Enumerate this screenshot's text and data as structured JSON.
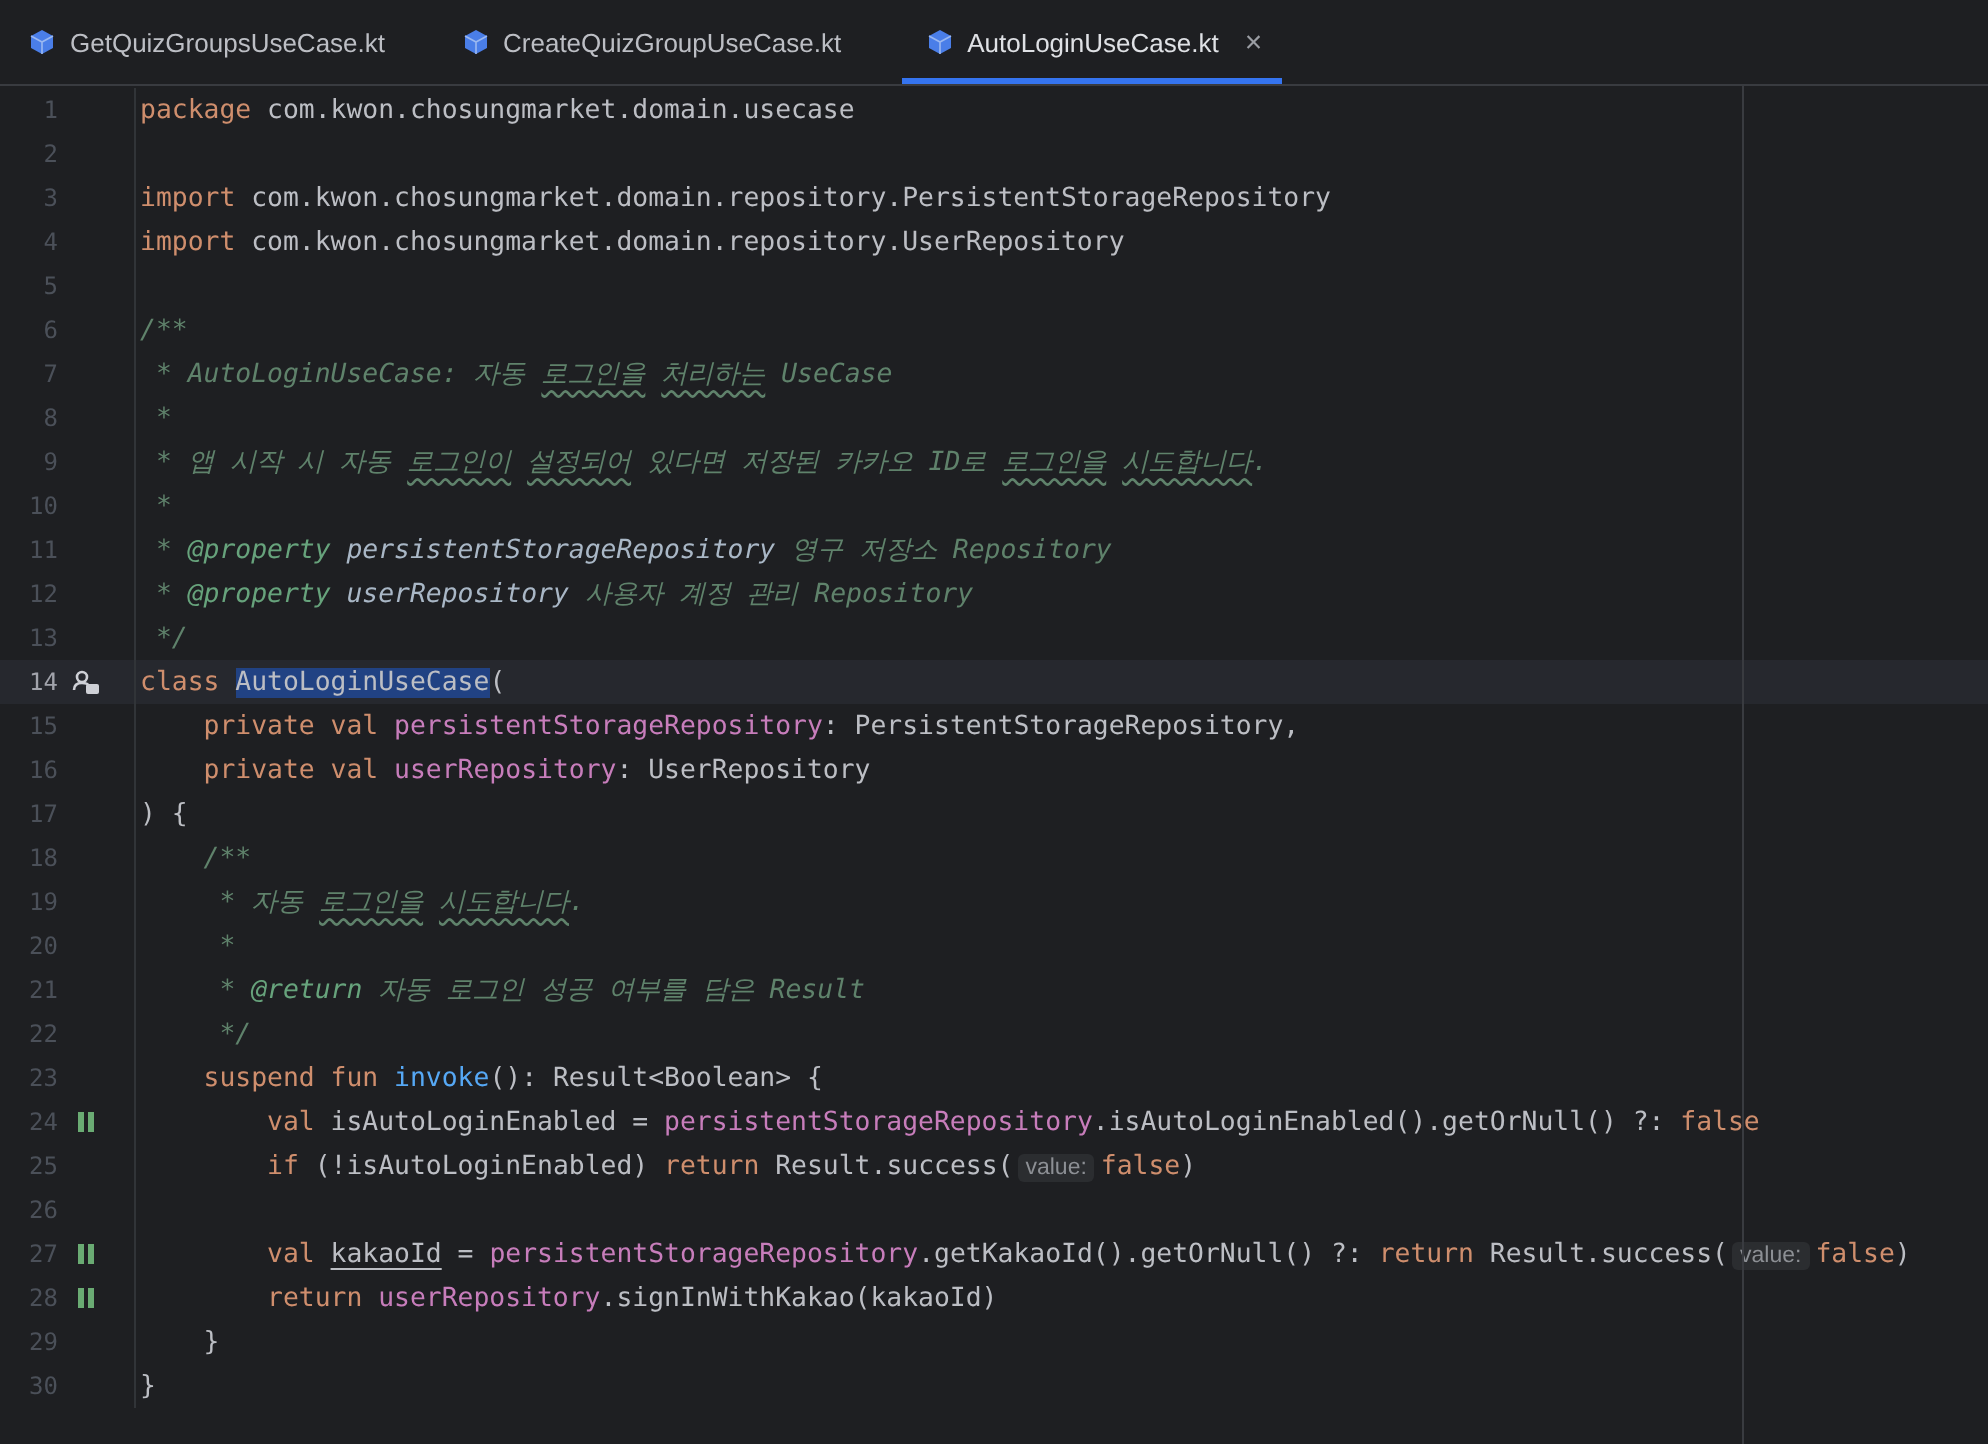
{
  "tabs": [
    {
      "label": "GetQuizGroupsUseCase.kt",
      "selected": false
    },
    {
      "label": "CreateQuizGroupUseCase.kt",
      "selected": false
    },
    {
      "label": "AutoLoginUseCase.kt",
      "selected": true,
      "close": "×"
    }
  ],
  "editor": {
    "lines": [
      {
        "number": "1",
        "tokens": [
          {
            "kind": "keyword",
            "text": "package"
          },
          {
            "kind": "plain",
            "text": " com.kwon.chosungmarket.domain.usecase"
          }
        ]
      },
      {
        "number": "2"
      },
      {
        "number": "3",
        "tokens": [
          {
            "kind": "keyword",
            "text": "import"
          },
          {
            "kind": "plain",
            "text": " com.kwon.chosungmarket.domain.repository.PersistentStorageRepository"
          }
        ]
      },
      {
        "number": "4",
        "tokens": [
          {
            "kind": "keyword",
            "text": "import"
          },
          {
            "kind": "plain",
            "text": " com.kwon.chosungmarket.domain.repository.UserRepository"
          }
        ]
      },
      {
        "number": "5"
      },
      {
        "number": "6",
        "tokens": [
          {
            "kind": "doc",
            "text": "/**"
          }
        ]
      },
      {
        "number": "7",
        "tokens": [
          {
            "kind": "doc",
            "text": " * AutoLoginUseCase: 자동 "
          },
          {
            "kind": "typo",
            "text": "로그인을 "
          },
          {
            "kind": "typo",
            "text": "처리하는"
          },
          {
            "kind": "doc",
            "text": " UseCase"
          }
        ]
      },
      {
        "number": "8",
        "tokens": [
          {
            "kind": "doc",
            "text": " *"
          }
        ]
      },
      {
        "number": "9",
        "tokens": [
          {
            "kind": "doc",
            "text": " * 앱 시작 시 자동 "
          },
          {
            "kind": "typo",
            "text": "로그인이 "
          },
          {
            "kind": "typo",
            "text": "설정되어"
          },
          {
            "kind": "doc",
            "text": " 있다면 저장된 카카오 ID로 "
          },
          {
            "kind": "typo",
            "text": "로그인을 "
          },
          {
            "kind": "typo",
            "text": "시도합니다"
          },
          {
            "kind": "doc",
            "text": "."
          }
        ]
      },
      {
        "number": "10",
        "tokens": [
          {
            "kind": "doc",
            "text": " *"
          }
        ]
      },
      {
        "number": "11",
        "tokens": [
          {
            "kind": "doc",
            "text": " * "
          },
          {
            "kind": "doc_tag",
            "text": "@property "
          },
          {
            "kind": "doc_param",
            "text": "persistentStorageRepository"
          },
          {
            "kind": "doc",
            "text": " 영구 저장소 Repository"
          }
        ]
      },
      {
        "number": "12",
        "tokens": [
          {
            "kind": "doc",
            "text": " * "
          },
          {
            "kind": "doc_tag",
            "text": "@property "
          },
          {
            "kind": "doc_param",
            "text": "userRepository"
          },
          {
            "kind": "doc",
            "text": " 사용자 계정 관리 Repository"
          }
        ]
      },
      {
        "number": "13",
        "tokens": [
          {
            "kind": "doc",
            "text": " */"
          }
        ]
      },
      {
        "number": "14",
        "current": true,
        "gutter_icon": {
          "kind": "author"
        },
        "tokens": [
          {
            "kind": "keyword",
            "text": "class "
          },
          {
            "kind": "selection",
            "text": "AutoLoginUseCase"
          },
          {
            "kind": "plain",
            "text": "("
          }
        ]
      },
      {
        "number": "15",
        "tokens": [
          {
            "kind": "keyword",
            "text": "    private val "
          },
          {
            "kind": "property",
            "text": "persistentStorageRepository"
          },
          {
            "kind": "plain",
            "text": ": PersistentStorageRepository,"
          }
        ]
      },
      {
        "number": "16",
        "tokens": [
          {
            "kind": "keyword",
            "text": "    private val "
          },
          {
            "kind": "property",
            "text": "userRepository"
          },
          {
            "kind": "plain",
            "text": ": UserRepository"
          }
        ]
      },
      {
        "number": "17",
        "tokens": [
          {
            "kind": "plain",
            "text": ") {"
          }
        ]
      },
      {
        "number": "18",
        "tokens": [
          {
            "kind": "doc",
            "text": "    /**"
          }
        ]
      },
      {
        "number": "19",
        "tokens": [
          {
            "kind": "doc",
            "text": "     * 자동 "
          },
          {
            "kind": "typo",
            "text": "로그인을 "
          },
          {
            "kind": "typo",
            "text": "시도합니다"
          },
          {
            "kind": "doc",
            "text": "."
          }
        ]
      },
      {
        "number": "20",
        "tokens": [
          {
            "kind": "doc",
            "text": "     *"
          }
        ]
      },
      {
        "number": "21",
        "tokens": [
          {
            "kind": "doc",
            "text": "     * "
          },
          {
            "kind": "doc_tag",
            "text": "@return"
          },
          {
            "kind": "doc",
            "text": " 자동 로그인 성공 여부를 담은 Result"
          }
        ]
      },
      {
        "number": "22",
        "tokens": [
          {
            "kind": "doc",
            "text": "     */"
          }
        ]
      },
      {
        "number": "23",
        "tokens": [
          {
            "kind": "keyword",
            "text": "    suspend fun "
          },
          {
            "kind": "function",
            "text": "invoke"
          },
          {
            "kind": "plain",
            "text": "(): Result<Boolean> {"
          }
        ]
      },
      {
        "number": "24",
        "gutter_icon": {
          "kind": "changed"
        },
        "tokens": [
          {
            "kind": "keyword",
            "text": "        val"
          },
          {
            "kind": "plain",
            "text": " isAutoLoginEnabled = "
          },
          {
            "kind": "property",
            "text": "persistentStorageRepository"
          },
          {
            "kind": "plain",
            "text": ".isAutoLoginEnabled().getOrNull() ?: "
          },
          {
            "kind": "keyword",
            "text": "false"
          }
        ]
      },
      {
        "number": "25",
        "tokens": [
          {
            "kind": "keyword",
            "text": "        if"
          },
          {
            "kind": "plain",
            "text": " (!isAutoLoginEnabled) "
          },
          {
            "kind": "keyword",
            "text": "return"
          },
          {
            "kind": "plain",
            "text": " Result.success("
          },
          {
            "kind": "hint",
            "text": "value:"
          },
          {
            "kind": "keyword",
            "text": "false"
          },
          {
            "kind": "plain",
            "text": ")"
          }
        ]
      },
      {
        "number": "26"
      },
      {
        "number": "27",
        "gutter_icon": {
          "kind": "changed"
        },
        "tokens": [
          {
            "kind": "keyword",
            "text": "        val "
          },
          {
            "kind": "underlined",
            "text": "kakaoId"
          },
          {
            "kind": "plain",
            "text": " = "
          },
          {
            "kind": "property",
            "text": "persistentStorageRepository"
          },
          {
            "kind": "plain",
            "text": ".getKakaoId().getOrNull() ?: "
          },
          {
            "kind": "keyword",
            "text": "return"
          },
          {
            "kind": "plain",
            "text": " Result.success("
          },
          {
            "kind": "hint",
            "text": "value:"
          },
          {
            "kind": "keyword",
            "text": "false"
          },
          {
            "kind": "plain",
            "text": ")"
          }
        ]
      },
      {
        "number": "28",
        "gutter_icon": {
          "kind": "changed"
        },
        "tokens": [
          {
            "kind": "keyword",
            "text": "        return "
          },
          {
            "kind": "property",
            "text": "userRepository"
          },
          {
            "kind": "plain",
            "text": ".signInWithKakao(kakaoId)"
          }
        ]
      },
      {
        "number": "29",
        "tokens": [
          {
            "kind": "plain",
            "text": "    }"
          }
        ]
      },
      {
        "number": "30",
        "tokens": [
          {
            "kind": "plain",
            "text": "}"
          }
        ]
      }
    ]
  }
}
